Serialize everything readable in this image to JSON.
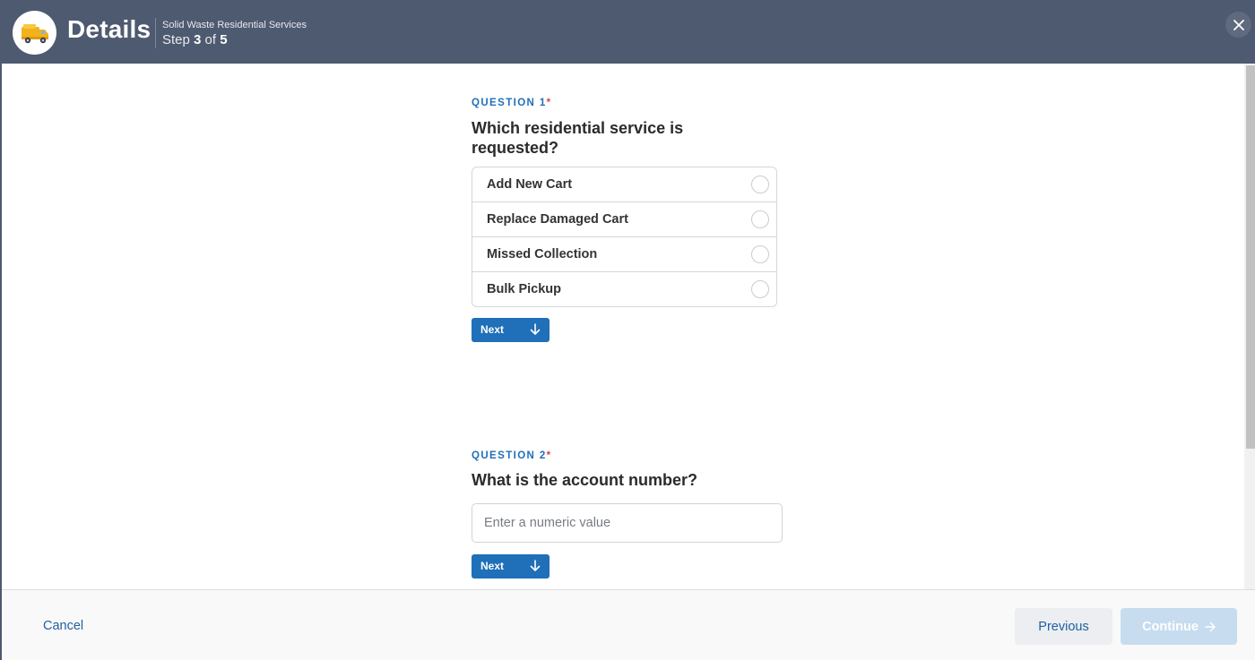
{
  "header": {
    "title": "Details",
    "service": "Solid Waste Residential Services",
    "step_prefix": "Step",
    "step_current": "3",
    "step_of": "of",
    "step_total": "5",
    "logo_icon": "garbage-truck-icon",
    "close_icon": "close-icon"
  },
  "question1": {
    "label": "QUESTION 1",
    "required_mark": "*",
    "title_line1": "Which residential service is",
    "title_line2": "requested?",
    "options": [
      {
        "label": "Add New Cart"
      },
      {
        "label": "Replace Damaged Cart"
      },
      {
        "label": "Missed Collection"
      },
      {
        "label": "Bulk Pickup"
      }
    ],
    "next_label": "Next"
  },
  "question2": {
    "label": "QUESTION 2",
    "required_mark": "*",
    "title": "What is the account number?",
    "input_placeholder": "Enter a numeric value",
    "input_value": "",
    "next_label": "Next"
  },
  "footer": {
    "cancel_label": "Cancel",
    "previous_label": "Previous",
    "continue_label": "Continue"
  },
  "colors": {
    "header_bg": "#4e5a6f",
    "accent_blue": "#1f6fb9",
    "required_red": "#d64545",
    "continue_disabled": "#c7dcef",
    "logo_yellow": "#f2b21b"
  }
}
